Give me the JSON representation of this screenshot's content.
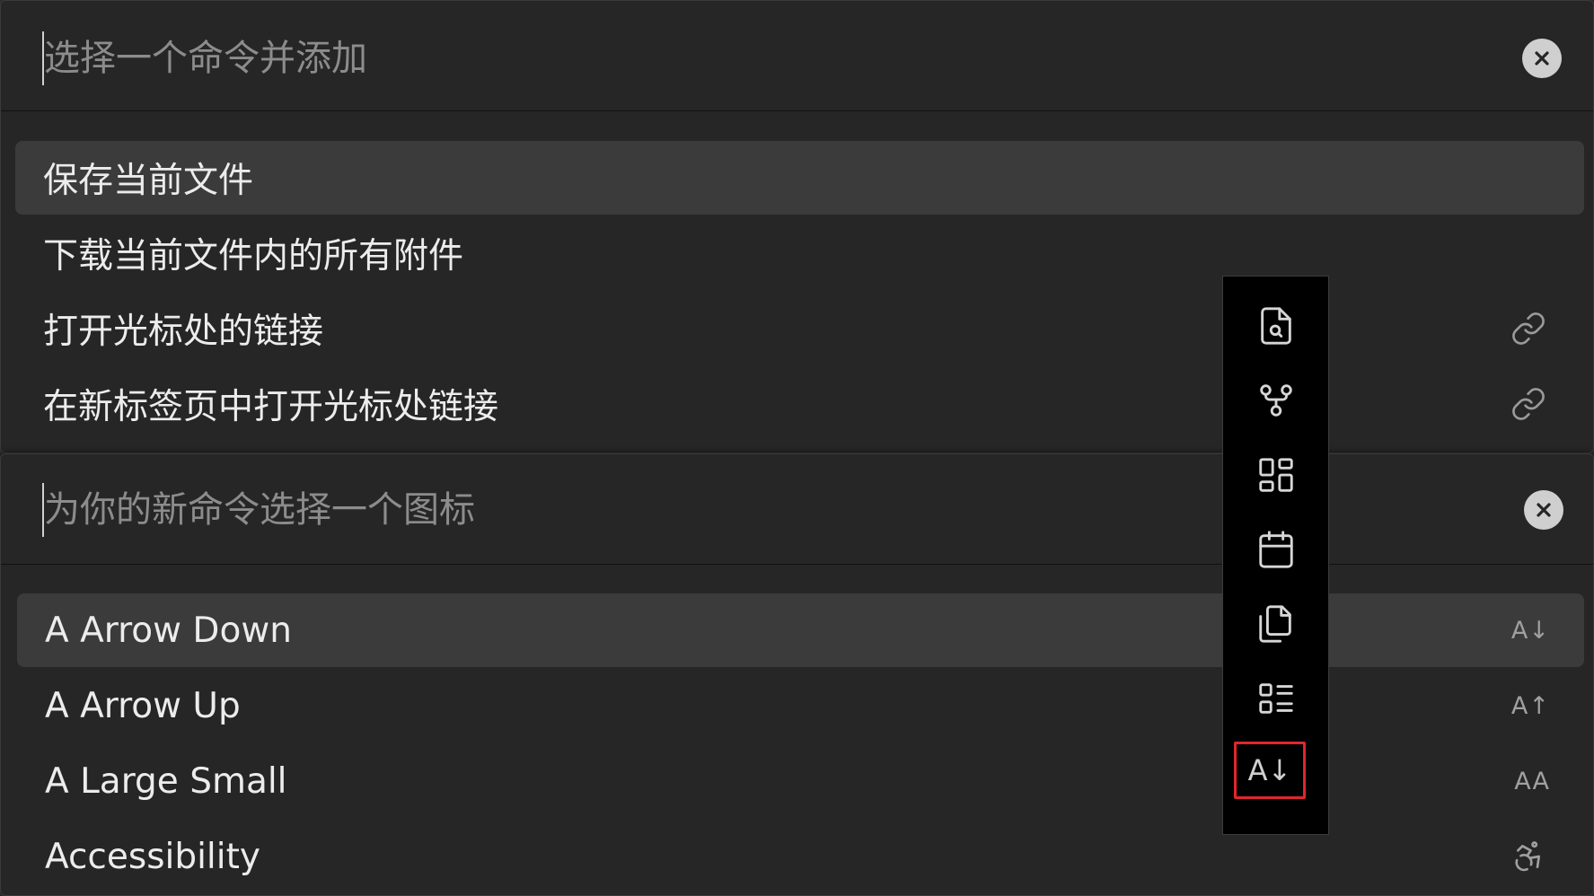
{
  "top_modal": {
    "placeholder": "选择一个命令并添加",
    "items": [
      {
        "label": "保存当前文件",
        "selected": true,
        "icon": "none"
      },
      {
        "label": "下载当前文件内的所有附件",
        "selected": false,
        "icon": "none"
      },
      {
        "label": "打开光标处的链接",
        "selected": false,
        "icon": "link-icon"
      },
      {
        "label": "在新标签页中打开光标处链接",
        "selected": false,
        "icon": "link-icon"
      }
    ]
  },
  "bottom_modal": {
    "placeholder": "为你的新命令选择一个图标",
    "items": [
      {
        "label": "A Arrow Down",
        "selected": true,
        "trailing": "A↓"
      },
      {
        "label": "A Arrow Up",
        "selected": false,
        "trailing": "A↑"
      },
      {
        "label": "A Large Small",
        "selected": false,
        "trailing": "AA"
      },
      {
        "label": "Accessibility",
        "selected": false,
        "trailing": "accessibility-icon"
      }
    ]
  },
  "ribbon": {
    "buttons": [
      {
        "icon": "file-search-icon"
      },
      {
        "icon": "git-fork-icon"
      },
      {
        "icon": "layout-grid-icon"
      },
      {
        "icon": "calendar-icon"
      },
      {
        "icon": "copy-files-icon"
      },
      {
        "icon": "list-icon"
      },
      {
        "icon": "a-arrow-down-icon",
        "text": "A↓",
        "highlighted": true
      }
    ]
  },
  "colors": {
    "background": "#262626",
    "selected_row": "#3b3b3b",
    "ribbon_background": "#000000",
    "highlight_border": "#e0262c"
  }
}
